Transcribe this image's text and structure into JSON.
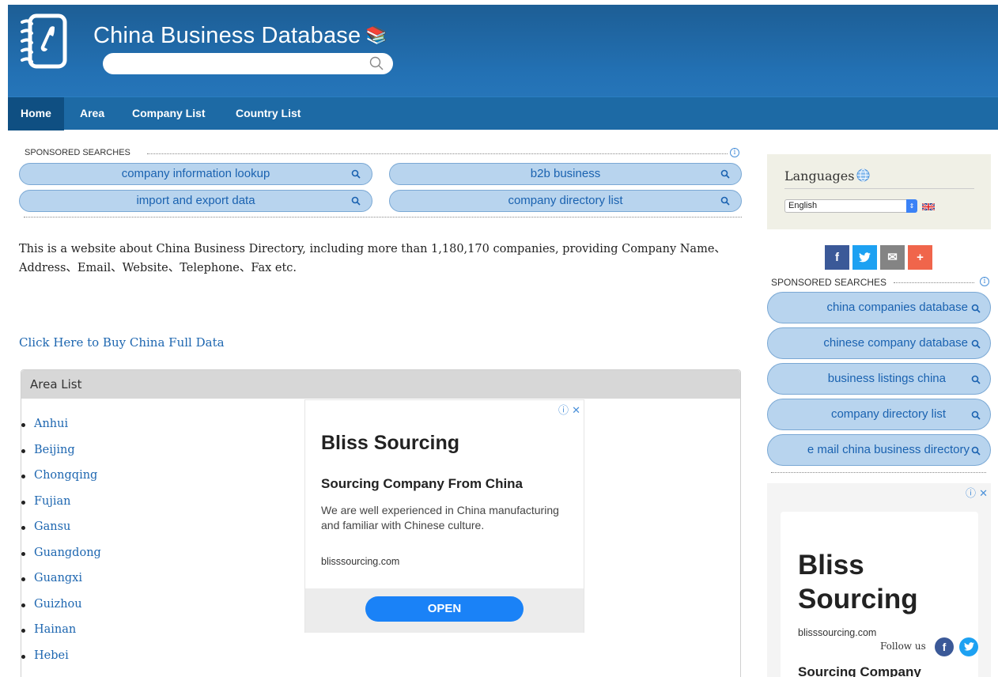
{
  "header": {
    "site_title": "China Business Database",
    "search_placeholder": "",
    "colors": {
      "header_bg": "#2371b4",
      "nav_bg": "#1d6aa5",
      "nav_active": "#0f4f82"
    }
  },
  "nav": {
    "items": [
      {
        "label": "Home",
        "active": true
      },
      {
        "label": "Area",
        "active": false
      },
      {
        "label": "Company List",
        "active": false
      },
      {
        "label": "Country List",
        "active": false
      }
    ]
  },
  "sponsored_top": {
    "label": "SPONSORED SEARCHES",
    "items": [
      "company information lookup",
      "b2b business",
      "import and export data",
      "company directory list"
    ]
  },
  "intro": {
    "text": "This is a website about China Business Directory, including more than 1,180,170 companies, providing Company Name、Address、Email、Website、Telephone、Fax etc."
  },
  "buy_link": "Click Here to Buy China Full Data",
  "area_list": {
    "title": "Area List",
    "items": [
      "Anhui",
      "Beijing",
      "Chongqing",
      "Fujian",
      "Gansu",
      "Guangdong",
      "Guangxi",
      "Guizhou",
      "Hainan",
      "Hebei"
    ]
  },
  "ad_main": {
    "close_label": "ⓘ ✕",
    "title": "Bliss Sourcing",
    "subtitle": "Sourcing Company From China",
    "description": "We are well experienced in China manufacturing and familiar with Chinese culture.",
    "domain": "blisssourcing.com",
    "button_label": "OPEN"
  },
  "languages": {
    "title": "Languages",
    "selected": "English",
    "icon": "globe-icon"
  },
  "share": {
    "facebook": "f",
    "twitter": "t",
    "email": "✉",
    "more": "+"
  },
  "sponsored_side": {
    "label": "SPONSORED SEARCHES",
    "items": [
      "china companies database",
      "chinese company database",
      "business listings china",
      "company directory list",
      "e mail china business directory"
    ]
  },
  "ad_side": {
    "close_label": "ⓘ ✕",
    "title": "Bliss Sourcing",
    "domain": "blisssourcing.com",
    "follow_label": "Follow us",
    "subtitle": "Sourcing Company"
  }
}
